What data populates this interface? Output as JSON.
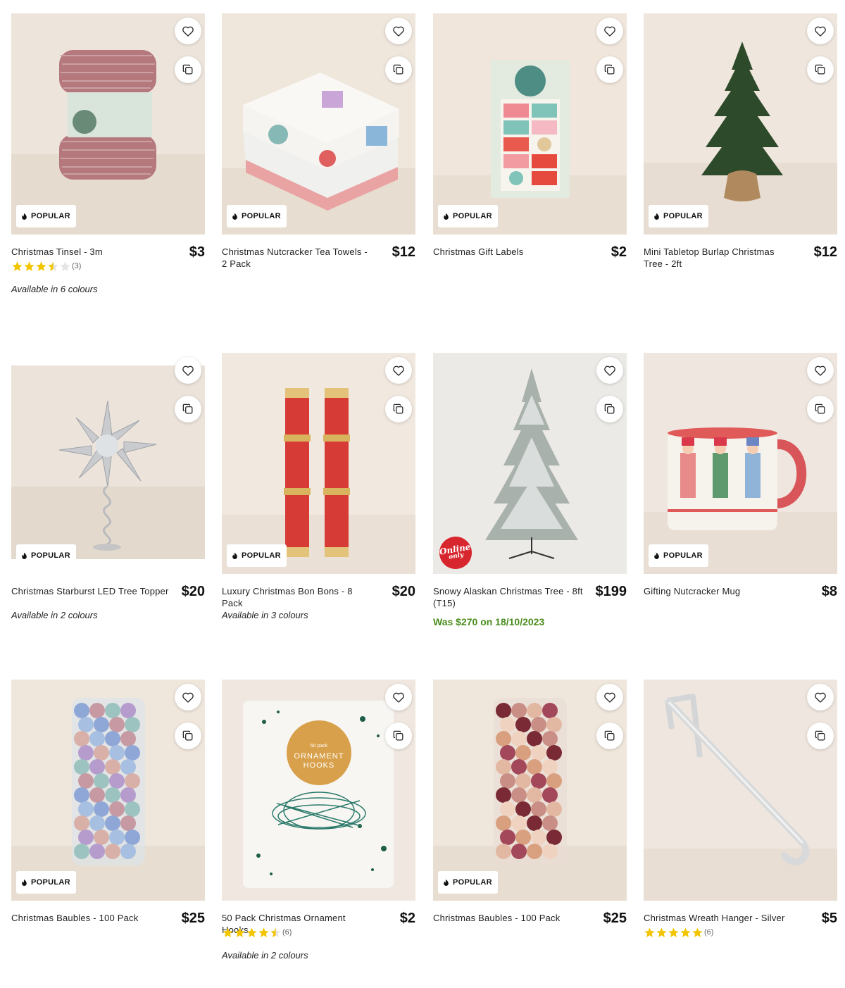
{
  "labels": {
    "badge": "POPULAR",
    "online_1": "Online",
    "online_2": "only"
  },
  "colors": {
    "price_was": "#4a8c1c",
    "star": "#f2c500",
    "online_badge": "#d7262e"
  },
  "products": [
    {
      "name": "Christmas Tinsel - 3m",
      "price": "$3",
      "popular": true,
      "rating": 3.5,
      "rating_count": "(3)",
      "colours": "Available in 6 colours"
    },
    {
      "name": "Christmas Nutcracker Tea Towels - 2 Pack",
      "price": "$12",
      "popular": true
    },
    {
      "name": "Christmas Gift Labels",
      "price": "$2",
      "popular": true
    },
    {
      "name": "Mini Tabletop Burlap Christmas Tree - 2ft",
      "price": "$12",
      "popular": true
    },
    {
      "name": "Christmas Starburst LED Tree Topper",
      "price": "$20",
      "popular": true,
      "colours": "Available in 2 colours"
    },
    {
      "name": "Luxury Christmas Bon Bons - 8 Pack",
      "price": "$20",
      "popular": true,
      "colours": "Available in 3 colours"
    },
    {
      "name": "Snowy Alaskan Christmas Tree - 8ft (T15)",
      "price": "$199",
      "online_only": true,
      "was": "Was $270 on 18/10/2023"
    },
    {
      "name": "Gifting Nutcracker Mug",
      "price": "$8",
      "popular": true
    },
    {
      "name": "Christmas Baubles - 100 Pack",
      "price": "$25",
      "popular": true
    },
    {
      "name": "50 Pack Christmas Ornament Hooks",
      "price": "$2",
      "rating": 4.5,
      "rating_count": "(6)",
      "colours": "Available in 2 colours",
      "pack_text_1": "50 pack",
      "pack_text_2": "ORNAMENT",
      "pack_text_3": "HOOKS"
    },
    {
      "name": "Christmas Baubles - 100 Pack",
      "price": "$25",
      "popular": true
    },
    {
      "name": "Christmas Wreath Hanger - Silver",
      "price": "$5",
      "rating": 5,
      "rating_count": "(6)"
    }
  ]
}
